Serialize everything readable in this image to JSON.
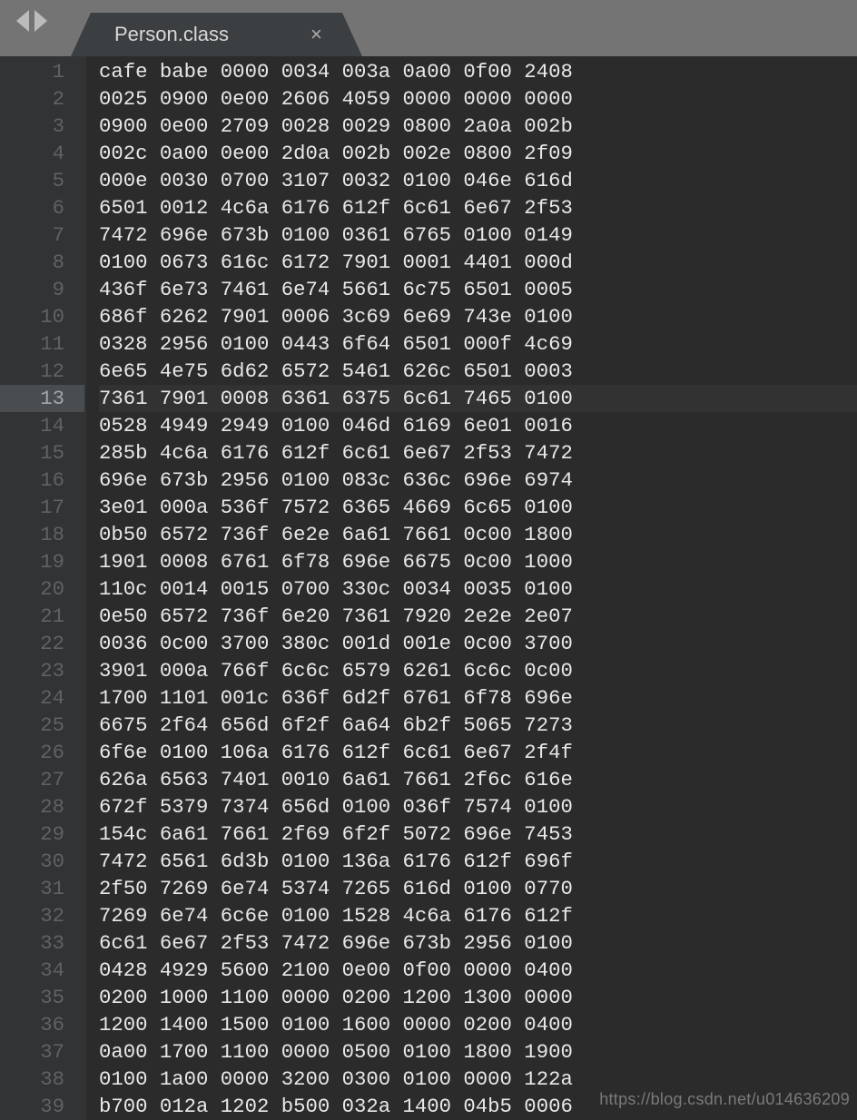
{
  "tab": {
    "title": "Person.class",
    "close_glyph": "×"
  },
  "current_line": 13,
  "lines": [
    "cafe babe 0000 0034 003a 0a00 0f00 2408",
    "0025 0900 0e00 2606 4059 0000 0000 0000",
    "0900 0e00 2709 0028 0029 0800 2a0a 002b",
    "002c 0a00 0e00 2d0a 002b 002e 0800 2f09",
    "000e 0030 0700 3107 0032 0100 046e 616d",
    "6501 0012 4c6a 6176 612f 6c61 6e67 2f53",
    "7472 696e 673b 0100 0361 6765 0100 0149",
    "0100 0673 616c 6172 7901 0001 4401 000d",
    "436f 6e73 7461 6e74 5661 6c75 6501 0005",
    "686f 6262 7901 0006 3c69 6e69 743e 0100",
    "0328 2956 0100 0443 6f64 6501 000f 4c69",
    "6e65 4e75 6d62 6572 5461 626c 6501 0003",
    "7361 7901 0008 6361 6375 6c61 7465 0100",
    "0528 4949 2949 0100 046d 6169 6e01 0016",
    "285b 4c6a 6176 612f 6c61 6e67 2f53 7472",
    "696e 673b 2956 0100 083c 636c 696e 6974",
    "3e01 000a 536f 7572 6365 4669 6c65 0100",
    "0b50 6572 736f 6e2e 6a61 7661 0c00 1800",
    "1901 0008 6761 6f78 696e 6675 0c00 1000",
    "110c 0014 0015 0700 330c 0034 0035 0100",
    "0e50 6572 736f 6e20 7361 7920 2e2e 2e07",
    "0036 0c00 3700 380c 001d 001e 0c00 3700",
    "3901 000a 766f 6c6c 6579 6261 6c6c 0c00",
    "1700 1101 001c 636f 6d2f 6761 6f78 696e",
    "6675 2f64 656d 6f2f 6a64 6b2f 5065 7273",
    "6f6e 0100 106a 6176 612f 6c61 6e67 2f4f",
    "626a 6563 7401 0010 6a61 7661 2f6c 616e",
    "672f 5379 7374 656d 0100 036f 7574 0100",
    "154c 6a61 7661 2f69 6f2f 5072 696e 7453",
    "7472 6561 6d3b 0100 136a 6176 612f 696f",
    "2f50 7269 6e74 5374 7265 616d 0100 0770",
    "7269 6e74 6c6e 0100 1528 4c6a 6176 612f",
    "6c61 6e67 2f53 7472 696e 673b 2956 0100",
    "0428 4929 5600 2100 0e00 0f00 0000 0400",
    "0200 1000 1100 0000 0200 1200 1300 0000",
    "1200 1400 1500 0100 1600 0000 0200 0400",
    "0a00 1700 1100 0000 0500 0100 1800 1900",
    "0100 1a00 0000 3200 0300 0100 0000 122a",
    "b700 012a 1202 b500 032a 1400 04b5 0006"
  ],
  "watermark": "https://blog.csdn.net/u014636209"
}
